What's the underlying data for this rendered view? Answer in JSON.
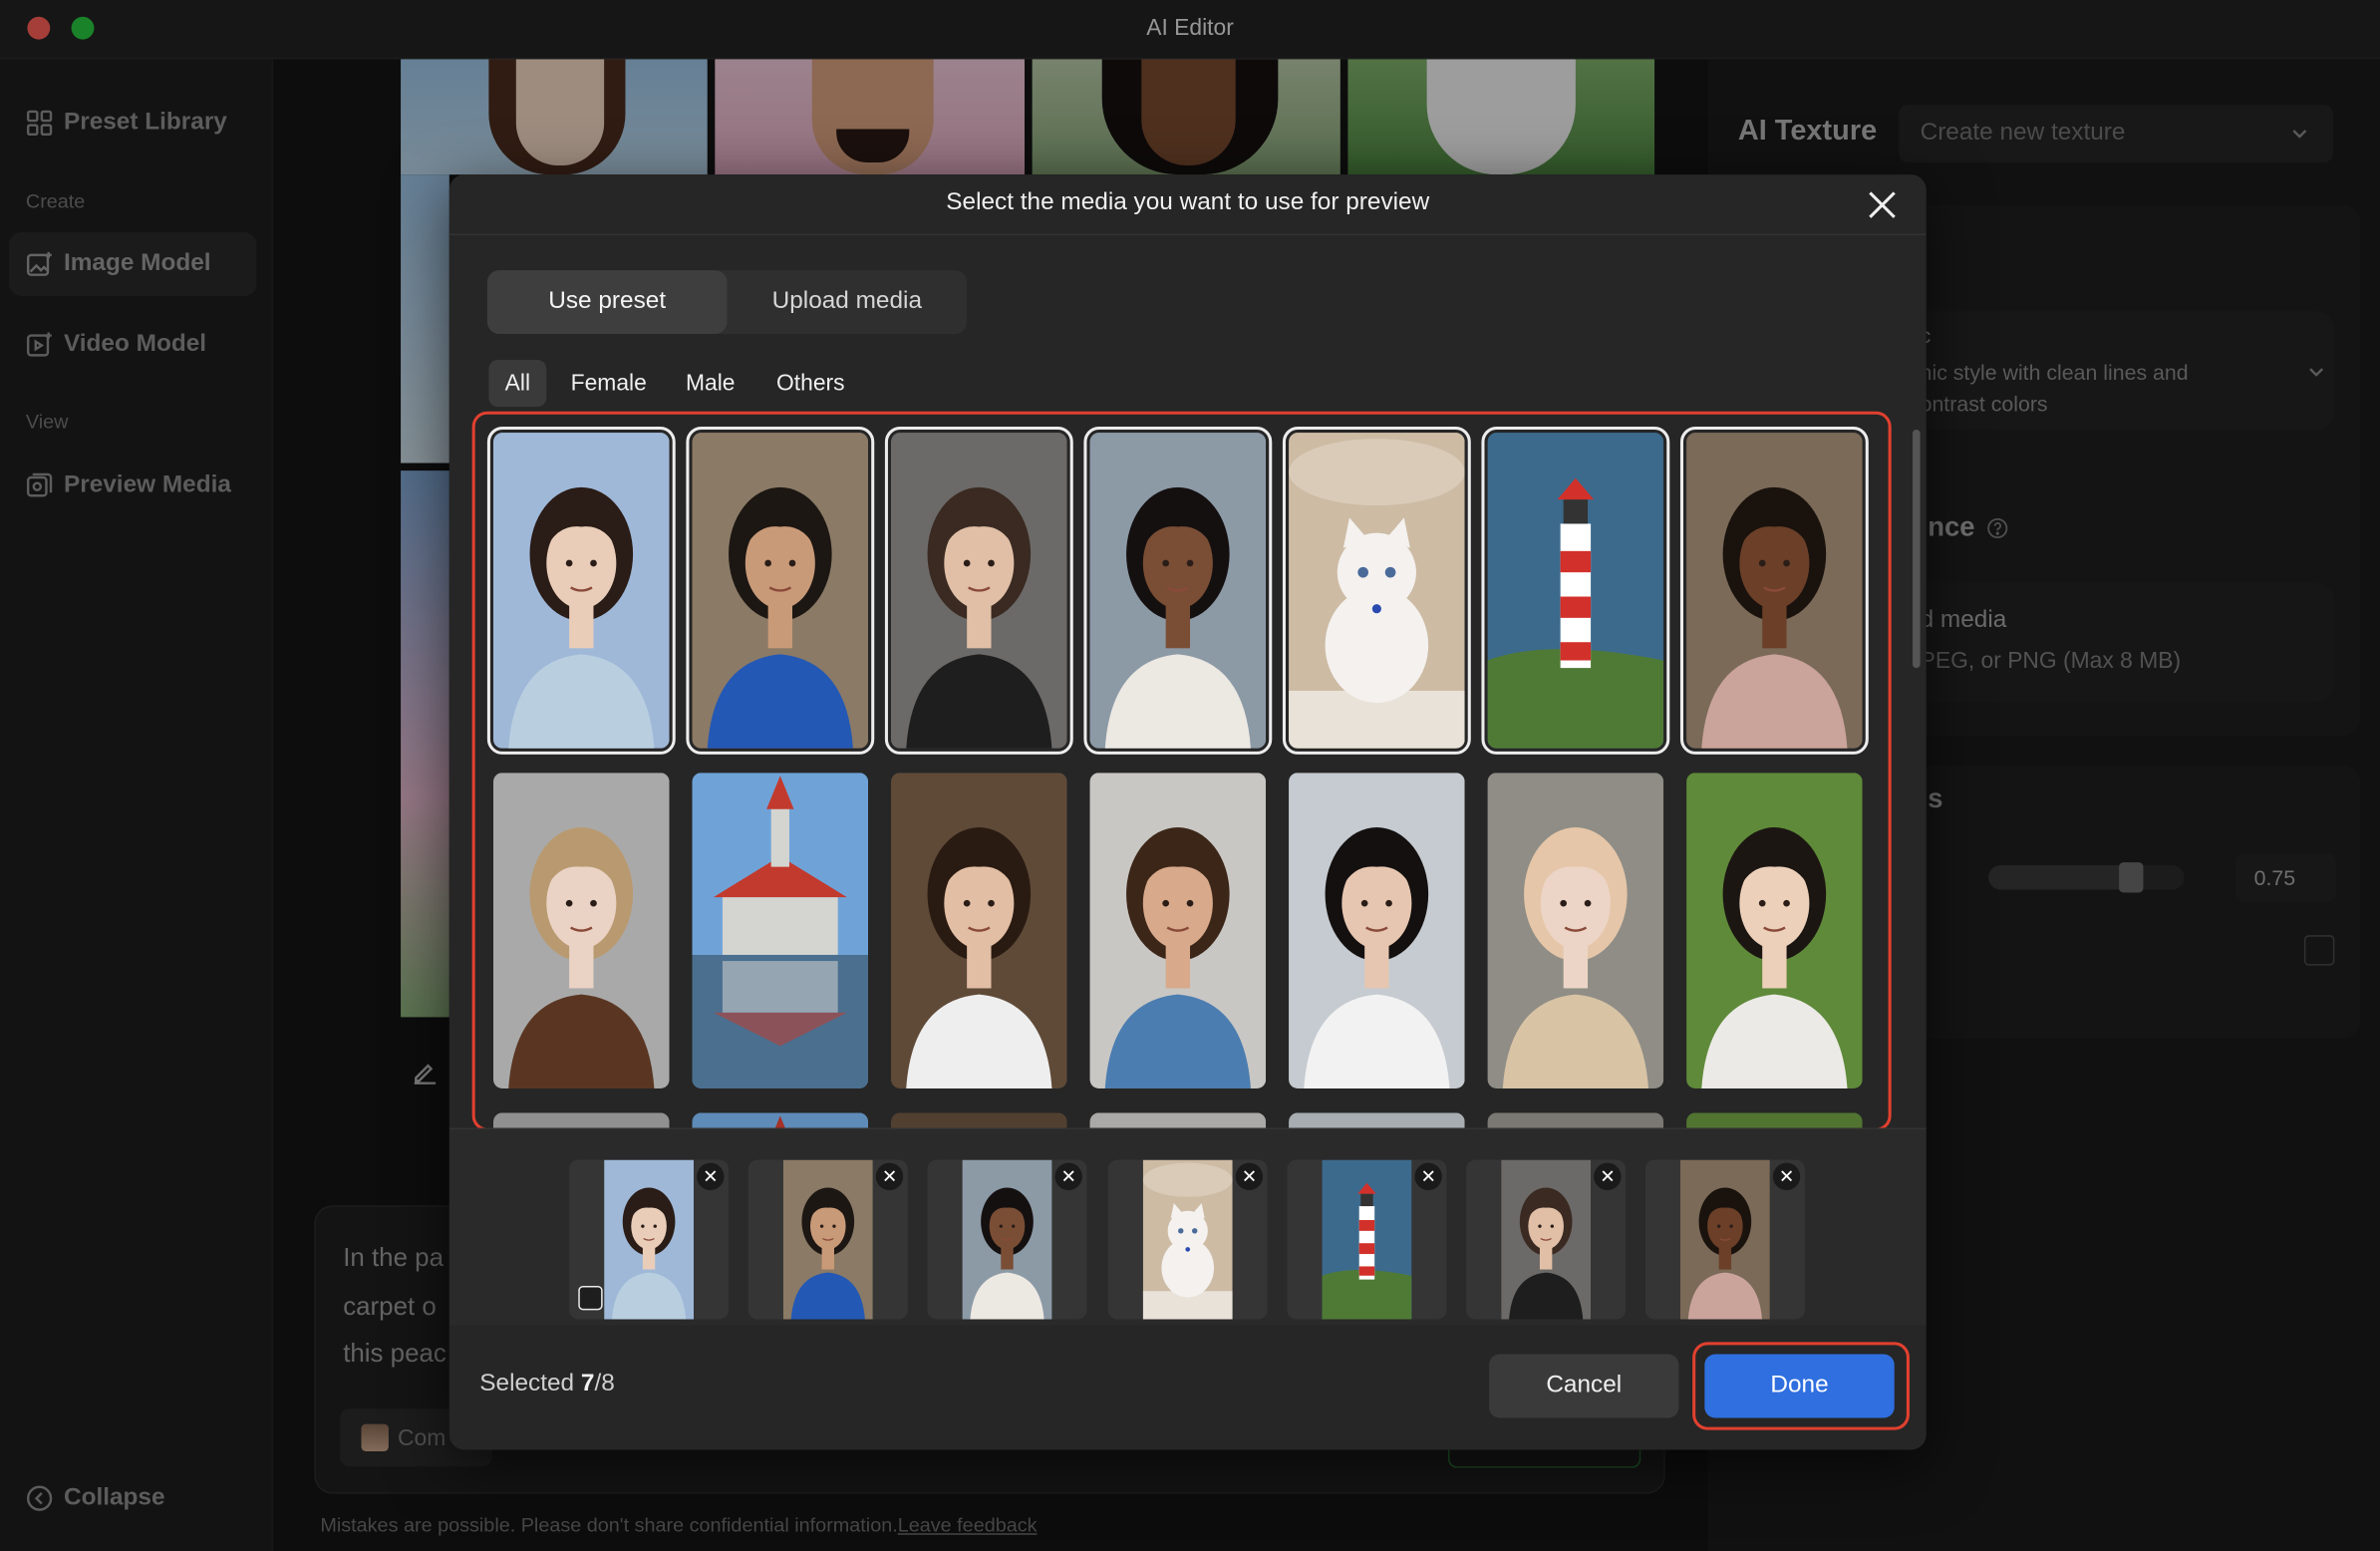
{
  "window": {
    "title": "AI Editor"
  },
  "sidebar": {
    "preset_library": "Preset Library",
    "section_create": "Create",
    "image_model": "Image Model",
    "video_model": "Video Model",
    "section_view": "View",
    "preview_media": "Preview Media",
    "collapse": "Collapse"
  },
  "right_panel": {
    "texture_label": "AI Texture",
    "texture_select": "Create new texture",
    "style_desc_line1": "c",
    "style_desc_line2": "hic style with clean lines and",
    "style_desc_line3": "ontrast colors",
    "reference_heading": "nce",
    "upload_label": "d media",
    "upload_hint": "PEG, or PNG (Max 8 MB)",
    "settings_heading": "s",
    "slider_value": "0.75",
    "slider_fraction": 0.72
  },
  "editor": {
    "prompt_line1": "In the pa",
    "prompt_line2": "carpet o",
    "prompt_line3": "this peac",
    "chip_label": "Com",
    "disclaimer": "Mistakes are possible. Please don't share confidential information.",
    "feedback_link": "Leave feedback"
  },
  "modal": {
    "title": "Select the media you want to use for preview",
    "tabs": [
      "Use preset",
      "Upload media"
    ],
    "active_tab": "Use preset",
    "filters": [
      "All",
      "Female",
      "Male",
      "Others"
    ],
    "active_filter": "All",
    "selected_prefix": "Selected ",
    "selected_count": "7",
    "selected_total": "/8",
    "cancel": "Cancel",
    "done": "Done"
  },
  "colors": {
    "accent": "#2f6fdf",
    "highlight": "#e2402f",
    "modal_bg": "#262626"
  },
  "presets": [
    {
      "name": "woman-long-hair-sky",
      "selected": true,
      "bg": "#9fb8d8",
      "skin": "#e9cdb9",
      "hair": "#2a1c16",
      "cloth": "#b9cfe0"
    },
    {
      "name": "man-blue-hoodie",
      "selected": true,
      "bg": "#8b7a66",
      "skin": "#c99a78",
      "hair": "#1c1713",
      "cloth": "#2358b5"
    },
    {
      "name": "woman-black-top",
      "selected": true,
      "bg": "#6c6a68",
      "skin": "#e0bfa6",
      "hair": "#3a2a22",
      "cloth": "#1e1e1e"
    },
    {
      "name": "woman-afro-white-cardigan",
      "selected": true,
      "bg": "#8c9aa6",
      "skin": "#7a4e35",
      "hair": "#151010",
      "cloth": "#ece8e2"
    },
    {
      "name": "white-kitten",
      "selected": true,
      "bg": "#cdbba4",
      "skin": "#f4f1ee",
      "hair": "#d9cbb8",
      "cloth": "#e8e2d8"
    },
    {
      "name": "lighthouse-sea",
      "selected": true,
      "bg": "#3c6a8c",
      "skin": "#ffffff",
      "hair": "#d2302a",
      "cloth": "#4f7a36"
    },
    {
      "name": "man-smiling-pink-tee",
      "selected": true,
      "bg": "#7b6a58",
      "skin": "#6b3f28",
      "hair": "#1a120d",
      "cloth": "#caa39a"
    },
    {
      "name": "woman-blonde-brown-blazer",
      "selected": false,
      "bg": "#a9a9a9",
      "skin": "#ead2c4",
      "hair": "#b99a70",
      "cloth": "#5a3622"
    },
    {
      "name": "church-reflection",
      "selected": false,
      "bg": "#6fa3d8",
      "skin": "#d4d4d0",
      "hair": "#c23a2e",
      "cloth": "#4b6f8f"
    },
    {
      "name": "man-white-sweater",
      "selected": false,
      "bg": "#5f4a38",
      "skin": "#e2bea4",
      "hair": "#2a1b12",
      "cloth": "#eeeeee"
    },
    {
      "name": "woman-curly-denim",
      "selected": false,
      "bg": "#c9c7c4",
      "skin": "#d8a98a",
      "hair": "#3c2618",
      "cloth": "#4b7db0"
    },
    {
      "name": "woman-city-graphic-tee",
      "selected": false,
      "bg": "#c5cbd0",
      "skin": "#e6c6b0",
      "hair": "#141010",
      "cloth": "#f2f2f2"
    },
    {
      "name": "woman-beige-dress",
      "selected": false,
      "bg": "#8f8d86",
      "skin": "#ecd5c6",
      "hair": "#e5c6a8",
      "cloth": "#d8c3a5"
    },
    {
      "name": "man-white-tee-greenery",
      "selected": false,
      "bg": "#5f8a3a",
      "skin": "#ecd0ba",
      "hair": "#1c1612",
      "cloth": "#eceae6"
    }
  ],
  "tray": [
    {
      "name": "woman-long-hair-sky"
    },
    {
      "name": "man-blue-hoodie"
    },
    {
      "name": "woman-afro-white-cardigan"
    },
    {
      "name": "white-kitten"
    },
    {
      "name": "lighthouse-sea"
    },
    {
      "name": "woman-black-top"
    },
    {
      "name": "man-smiling-pink-tee"
    }
  ]
}
